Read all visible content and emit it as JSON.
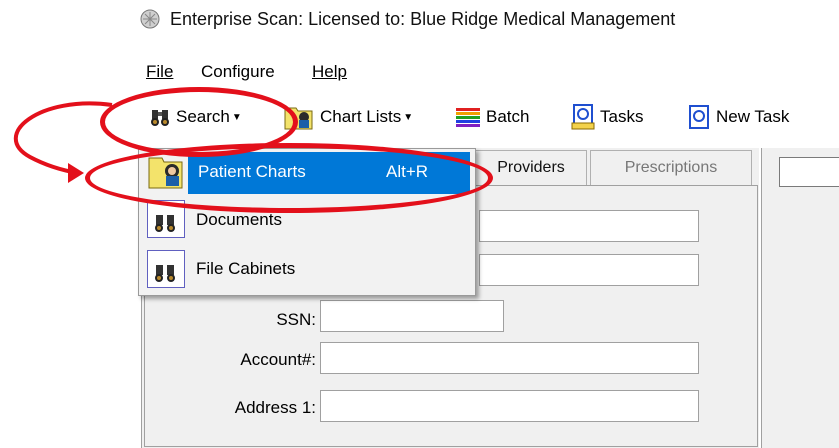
{
  "window": {
    "title": "Enterprise Scan: Licensed to: Blue Ridge Medical Management"
  },
  "menubar": {
    "items": [
      {
        "label": "File"
      },
      {
        "label": "Configure"
      },
      {
        "label": "Help"
      }
    ]
  },
  "toolbar": {
    "search_label": "Search",
    "chart_lists_label": "Chart Lists",
    "batch_label": "Batch",
    "tasks_label": "Tasks",
    "new_task_label": "New Task"
  },
  "tabs": {
    "providers": "Providers",
    "prescriptions": "Prescriptions"
  },
  "form": {
    "ssn_label": "SSN:",
    "account_label": "Account#:",
    "address1_label": "Address 1:"
  },
  "search_menu": {
    "items": [
      {
        "label": "Patient Charts",
        "shortcut": "Alt+R",
        "selected": true
      },
      {
        "label": "Documents",
        "shortcut": ""
      },
      {
        "label": "File Cabinets",
        "shortcut": ""
      }
    ]
  },
  "colors": {
    "highlight": "#0078d7",
    "annotation": "#e3101b"
  }
}
